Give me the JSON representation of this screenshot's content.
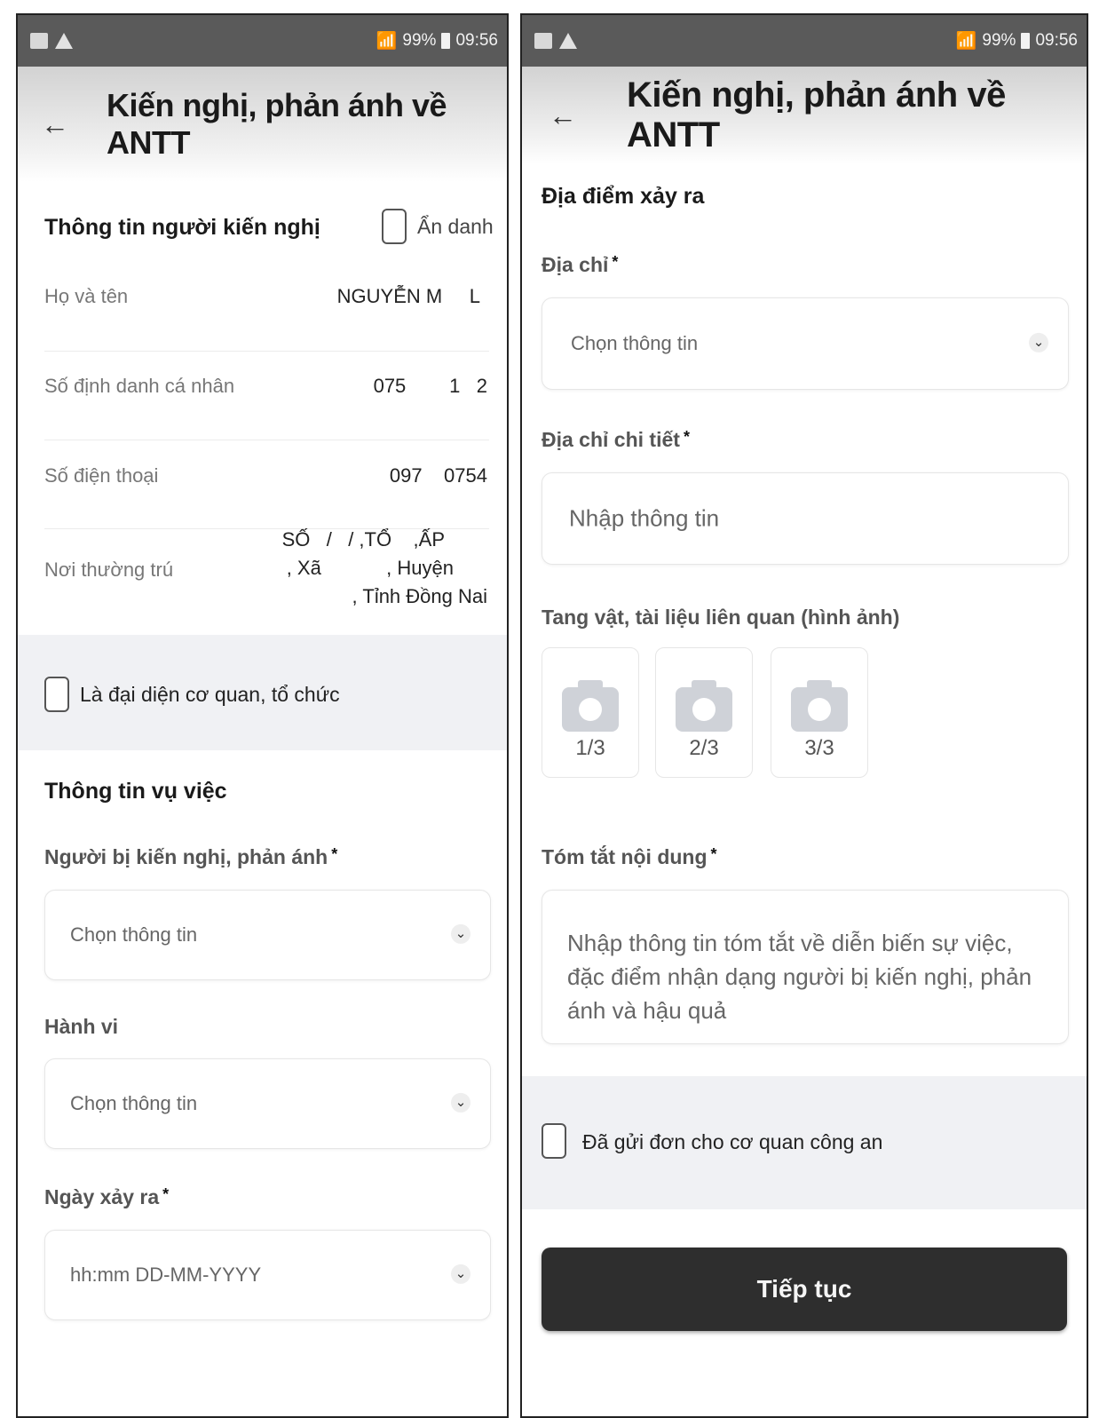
{
  "status_bar": {
    "battery": "99%",
    "time": "09:56"
  },
  "left": {
    "header": {
      "back_icon": "←",
      "title": "Kiến nghị, phản ánh về ANTT"
    },
    "petitioner": {
      "section_title": "Thông tin người kiến nghị",
      "anonymous_label": "Ẩn danh",
      "name_label": "Họ và tên",
      "name_value": "NGUYỄN M     L",
      "id_label": "Số định danh cá nhân",
      "id_value": "075        1   2",
      "phone_label": "Số điện thoại",
      "phone_value": "097    0754",
      "residence_label": "Nơi thường trú",
      "residence_line1": "SỐ   /   / ,TỔ    ,ẤP",
      "residence_line2": ", Xã            , Huyện",
      "residence_line3": ", Tỉnh Đồng Nai"
    },
    "organization_checkbox_label": "Là đại diện cơ quan, tổ chức",
    "case": {
      "section_title": "Thông tin vụ việc",
      "accused_label": "Người bị kiến nghị, phản ánh",
      "accused_placeholder": "Chọn thông tin",
      "behavior_label": "Hành vi",
      "behavior_placeholder": "Chọn thông tin",
      "date_label": "Ngày xảy ra",
      "date_placeholder": "hh:mm DD-MM-YYYY"
    },
    "required_mark": "*",
    "chevron": "⌄"
  },
  "right": {
    "header": {
      "back_icon": "←",
      "title": "Kiến nghị, phản ánh về ANTT"
    },
    "location_title": "Địa điểm xảy ra",
    "address_label": "Địa chỉ",
    "address_placeholder": "Chọn thông tin",
    "detail_label": "Địa chỉ chi tiết",
    "detail_placeholder": "Nhập thông tin",
    "evidence_label": "Tang vật, tài liệu liên quan (hình ảnh)",
    "photos": [
      "1/3",
      "2/3",
      "3/3"
    ],
    "summary_label": "Tóm tắt nội dung",
    "summary_placeholder": "Nhập thông tin tóm tắt về diễn biến sự việc, đặc điểm nhận dạng người bị kiến nghị, phản ánh và hậu quả",
    "sent_checkbox_label": "Đã gửi đơn cho cơ quan công an",
    "continue_button": "Tiếp tục",
    "required_mark": "*",
    "chevron": "⌄"
  }
}
